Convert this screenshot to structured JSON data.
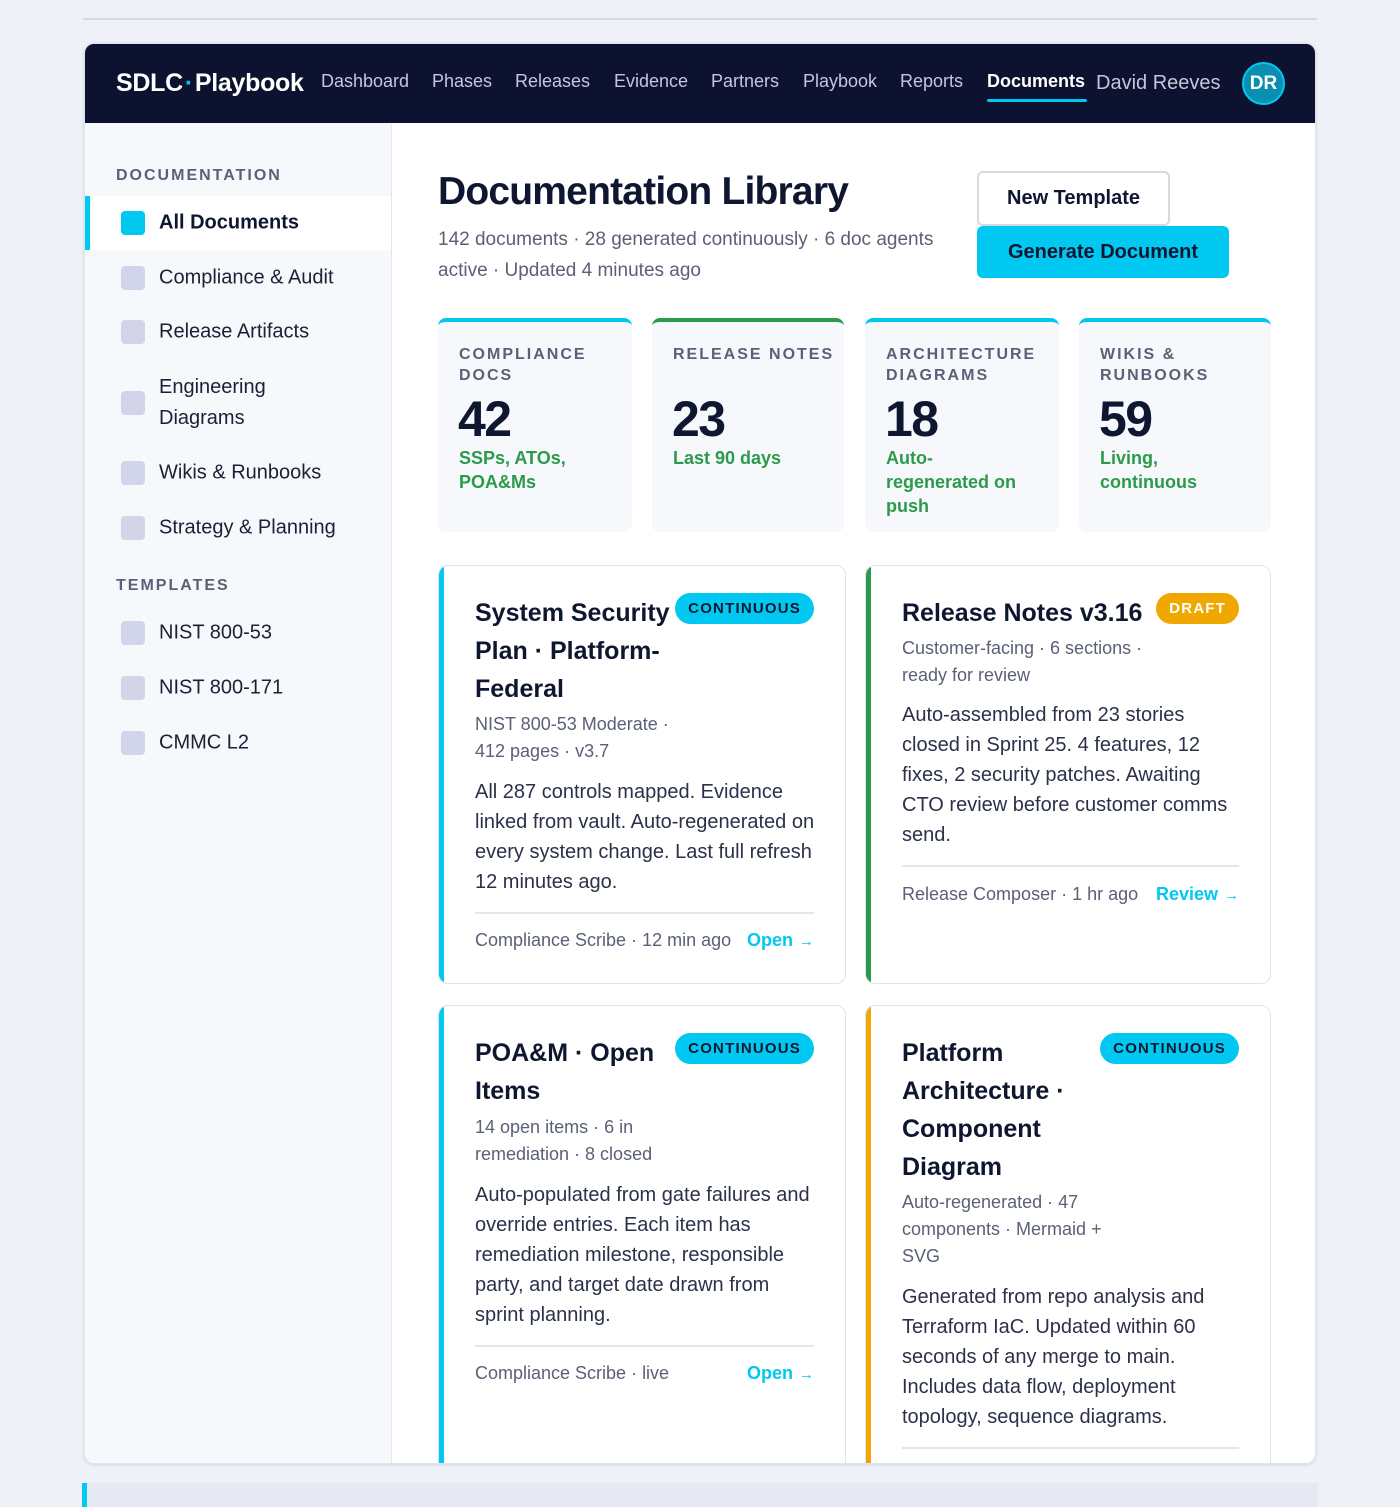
{
  "brand": {
    "left": "SDLC",
    "dot": "·",
    "right": "Playbook"
  },
  "nav": {
    "items": [
      "Dashboard",
      "Phases",
      "Releases",
      "Evidence",
      "Partners",
      "Playbook",
      "Reports",
      "Documents"
    ],
    "active": "Documents"
  },
  "user": {
    "name": "David Reeves",
    "initials": "DR"
  },
  "sidebar": {
    "documentation_heading": "DOCUMENTATION",
    "documentation_items": [
      "All Documents",
      "Compliance & Audit",
      "Release Artifacts",
      "Engineering Diagrams",
      "Wikis & Runbooks",
      "Strategy & Planning"
    ],
    "templates_heading": "TEMPLATES",
    "template_items": [
      "NIST 800-53",
      "NIST 800-171",
      "CMMC L2"
    ]
  },
  "page": {
    "title": "Documentation Library",
    "subtitle": "142 documents · 28 generated continuously · 6 doc agents active · Updated 4 minutes ago",
    "new_template_label": "New Template",
    "generate_label": "Generate Document"
  },
  "stats": [
    {
      "label": "COMPLIANCE DOCS",
      "value": "42",
      "note": "SSPs, ATOs, POA&Ms",
      "accent": "#00c8f0"
    },
    {
      "label": "RELEASE NOTES",
      "value": "23",
      "note": "Last 90 days",
      "accent": "#2b9a4b"
    },
    {
      "label": "ARCHITECTURE DIAGRAMS",
      "value": "18",
      "note": "Auto-regenerated on push",
      "accent": "#00c8f0"
    },
    {
      "label": "WIKIS & RUNBOOKS",
      "value": "59",
      "note": "Living, continuous",
      "accent": "#00c8f0"
    }
  ],
  "cards": [
    {
      "title": "System Security Plan · Platform-Federal",
      "badge": "CONTINUOUS",
      "meta": "NIST 800-53 Moderate · 412 pages · v3.7",
      "body": "All 287 controls mapped. Evidence linked from vault. Auto-regenerated on every system change. Last full refresh 12 minutes ago.",
      "footer": "Compliance Scribe · 12 min ago",
      "link": "Open",
      "arrow": "→",
      "accent": "#00c8f0"
    },
    {
      "title": "Release Notes v3.16",
      "badge": "DRAFT",
      "meta": "Customer-facing · 6 sections · ready for review",
      "body": "Auto-assembled from 23 stories closed in Sprint 25. 4 features, 12 fixes, 2 security patches. Awaiting CTO review before customer comms send.",
      "footer": "Release Composer · 1 hr ago",
      "link": "Review",
      "arrow": "→",
      "accent": "#2b9a4b"
    },
    {
      "title": "POA&M · Open Items",
      "badge": "CONTINUOUS",
      "meta": "14 open items · 6 in remediation · 8 closed",
      "body": "Auto-populated from gate failures and override entries. Each item has remediation milestone, responsible party, and target date drawn from sprint planning.",
      "footer": "Compliance Scribe · live",
      "link": "Open",
      "arrow": "→",
      "accent": "#00c8f0"
    },
    {
      "title": "Platform Architecture · Component Diagram",
      "badge": "CONTINUOUS",
      "meta": "Auto-regenerated · 47 components · Mermaid + SVG",
      "body": "Generated from repo analysis and Terraform IaC. Updated within 60 seconds of any merge to main. Includes data flow, deployment topology, sequence diagrams.",
      "accent": "#f0a800"
    }
  ]
}
